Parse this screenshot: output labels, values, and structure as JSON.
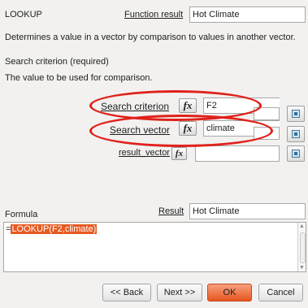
{
  "header": {
    "function_name": "LOOKUP",
    "function_result_label": "Function result",
    "function_result_value": "Hot Climate"
  },
  "description": "Determines a value in a vector by comparison to values in another vector.",
  "argument_info": {
    "title": "Search criterion (required)",
    "text": "The value to be used for comparison."
  },
  "args": [
    {
      "label": "Search criterion",
      "value": "F2",
      "fx": "fx"
    },
    {
      "label": "Search vector",
      "value": "climate",
      "fx": "fx"
    },
    {
      "label": "result_vector",
      "value": "",
      "fx": "fx"
    }
  ],
  "bottom": {
    "formula_label": "Formula",
    "result_label": "Result",
    "result_value": "Hot Climate",
    "formula_prefix": "=",
    "formula_text": "LOOKUP(F2,climate)"
  },
  "buttons": {
    "back": "<< Back",
    "next": "Next >>",
    "ok": "OK",
    "cancel": "Cancel"
  },
  "colors": {
    "highlight_ring": "#e0211b",
    "ok_button": "#e7561f",
    "selection": "#e65a21"
  }
}
